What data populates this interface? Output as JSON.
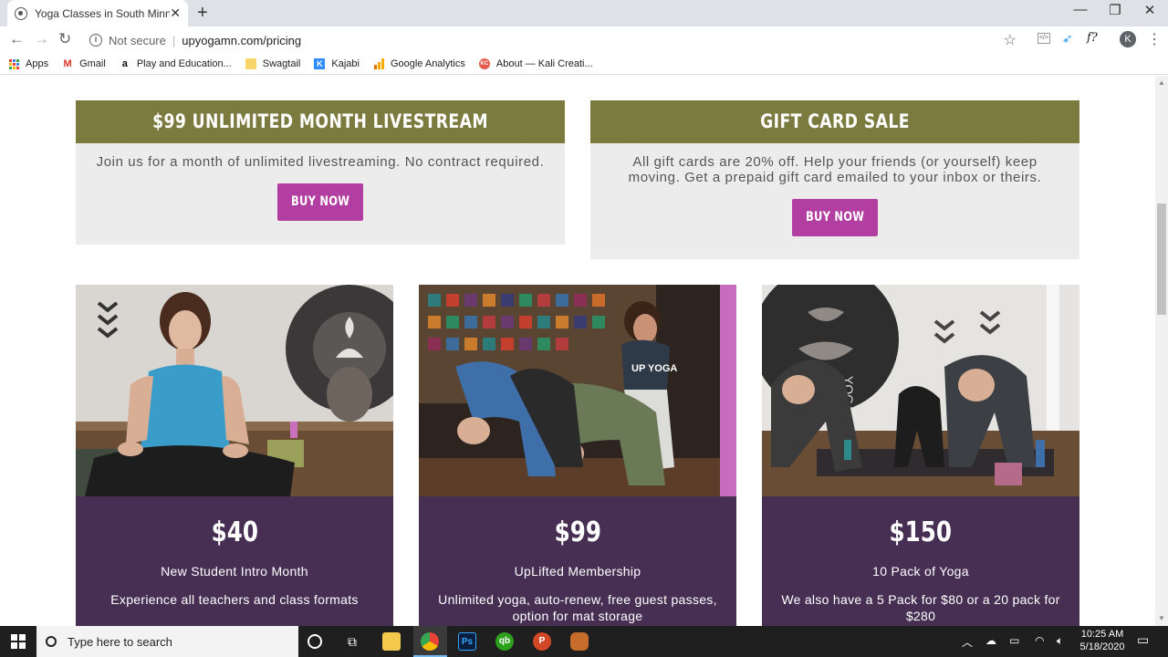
{
  "browser": {
    "tab_title": "Yoga Classes in South Minneapolis",
    "new_tab": "+",
    "security_label": "Not secure",
    "url": "upyogamn.com/pricing",
    "profile_initial": "K",
    "extension_label": "f?"
  },
  "bookmarks": [
    {
      "label": "Apps",
      "icon": "apps-grid-icon"
    },
    {
      "label": "Gmail",
      "icon": "gmail-icon"
    },
    {
      "label": "Play and Education...",
      "icon": "amazon-icon"
    },
    {
      "label": "Swagtail",
      "icon": "folder-icon"
    },
    {
      "label": "Kajabi",
      "icon": "kajabi-icon"
    },
    {
      "label": "Google Analytics",
      "icon": "analytics-icon"
    },
    {
      "label": "About — Kali Creati...",
      "icon": "kali-icon"
    }
  ],
  "promos": [
    {
      "title": "$99 UNLIMITED MONTH LIVESTREAM",
      "text": "Join us for a month of unlimited livestreaming. No contract required.",
      "button": "BUY NOW"
    },
    {
      "title": "GIFT CARD SALE",
      "text": "All gift cards are 20% off. Help your friends (or yourself) keep moving. Get a prepaid gift card emailed to your inbox or theirs.",
      "button": "BUY NOW"
    }
  ],
  "plans": [
    {
      "price": "$40",
      "name": "New Student Intro Month",
      "desc": "Experience all teachers and class formats"
    },
    {
      "price": "$99",
      "name": "UpLifted Membership",
      "desc": "Unlimited yoga, auto-renew, free guest passes, option for mat storage"
    },
    {
      "price": "$150",
      "name": "10 Pack of Yoga",
      "desc": "We also have a 5 Pack for $80 or a 20 pack for $280"
    }
  ],
  "photo_text": {
    "shirt": "UP YOGA",
    "wall": "YOGA"
  },
  "taskbar": {
    "search_placeholder": "Type here to search",
    "time": "10:25 AM",
    "date": "5/18/2020"
  },
  "colors": {
    "olive_header": "#7b7a3f",
    "magenta_button": "#b33ea1",
    "plum_card": "#472f54",
    "promo_bg": "#ececed"
  }
}
